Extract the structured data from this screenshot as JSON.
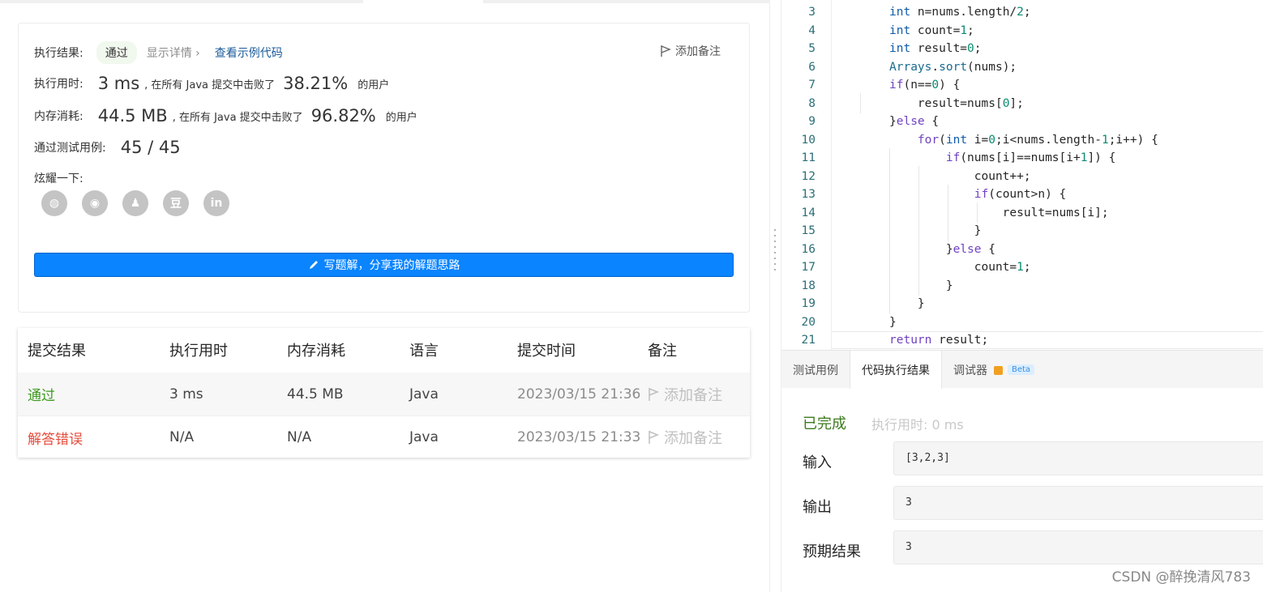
{
  "left": {
    "result_label": "执行结果:",
    "status": "通过",
    "detail": "显示详情 ›",
    "example": "查看示例代码",
    "add_note": "添加备注",
    "runtime_label": "执行用时:",
    "runtime_value": "3 ms",
    "runtime_mid": ", 在所有 Java 提交中击败了",
    "runtime_pct": "38.21%",
    "runtime_suffix": "的用户",
    "memory_label": "内存消耗:",
    "memory_value": "44.5 MB",
    "memory_mid": ", 在所有 Java 提交中击败了",
    "memory_pct": "96.82%",
    "memory_suffix": "的用户",
    "tests_label": "通过测试用例:",
    "tests_value": "45 / 45",
    "share_label": "炫耀一下:",
    "share_icons": [
      "wechat-icon",
      "weibo-icon",
      "qq-icon",
      "douban-icon",
      "linkedin-icon"
    ],
    "share_glyphs": [
      "◍",
      "◉",
      "♟",
      "豆",
      "in"
    ],
    "write_button": "写题解，分享我的解题思路"
  },
  "table": {
    "headers": [
      "提交结果",
      "执行用时",
      "内存消耗",
      "语言",
      "提交时间",
      "备注"
    ],
    "rows": [
      {
        "status": "通过",
        "runtime": "3 ms",
        "memory": "44.5 MB",
        "lang": "Java",
        "time": "2023/03/15 21:36",
        "note": "添加备注"
      },
      {
        "status": "解答错误",
        "runtime": "N/A",
        "memory": "N/A",
        "lang": "Java",
        "time": "2023/03/15 21:33",
        "note": "添加备注"
      }
    ]
  },
  "editor": {
    "line_numbers": [
      "3",
      "4",
      "5",
      "6",
      "7",
      "8",
      "9",
      "10",
      "11",
      "12",
      "13",
      "14",
      "15",
      "16",
      "17",
      "18",
      "19",
      "20",
      "21"
    ]
  },
  "console": {
    "tabs": [
      "测试用例",
      "代码执行结果",
      "调试器"
    ],
    "beta": "Beta",
    "status": "已完成",
    "exec_time": "执行用时: 0 ms",
    "input_label": "输入",
    "input_value": "[3,2,3]",
    "output_label": "输出",
    "output_value": "3",
    "expected_label": "预期结果",
    "expected_value": "3"
  },
  "watermark": "CSDN @醉挽清风783",
  "colors": {
    "accent": "#0a84ff",
    "pass": "#3c9a1d",
    "fail": "#e74c3c"
  }
}
